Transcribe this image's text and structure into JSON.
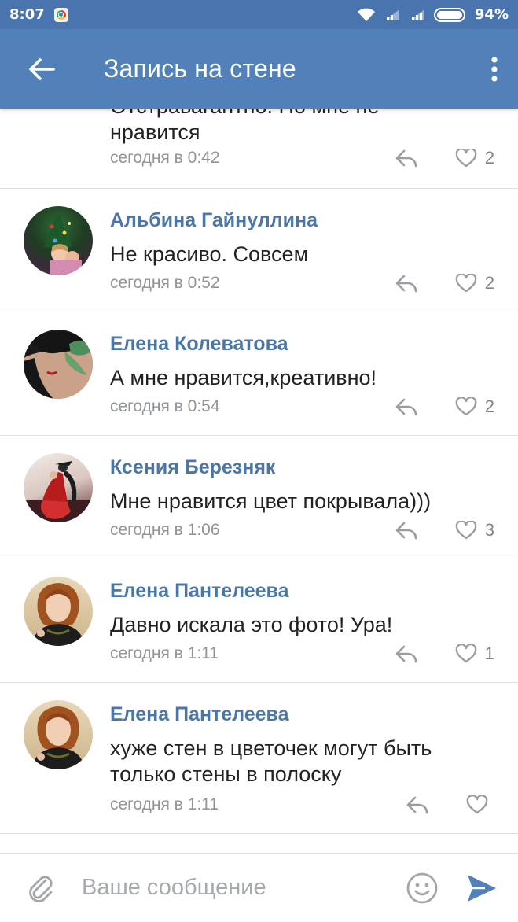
{
  "status_bar": {
    "time": "8:07",
    "battery": "94%"
  },
  "app_bar": {
    "title": "Запись на стене",
    "back_icon": "arrow-left-icon",
    "more_icon": "more-vertical-icon"
  },
  "comments": [
    {
      "author": "",
      "text_lines": [
        "Отстравагантно. Но мне не",
        "нравится"
      ],
      "time": "сегодня в 0:42",
      "likes": "2"
    },
    {
      "author": "Альбина Гайнуллина",
      "text_lines": [
        "Не красиво. Совсем"
      ],
      "time": "сегодня в 0:52",
      "likes": "2"
    },
    {
      "author": "Елена Колеватова",
      "text_lines": [
        "А мне нравится,креативно!"
      ],
      "time": "сегодня в 0:54",
      "likes": "2"
    },
    {
      "author": "Ксения Березняк",
      "text_lines": [
        "Мне нравится цвет покрывала)))"
      ],
      "time": "сегодня в 1:06",
      "likes": "3"
    },
    {
      "author": "Елена Пантелеева",
      "text_lines": [
        "Давно искала это фото! Ура!"
      ],
      "time": "сегодня в 1:11",
      "likes": "1"
    },
    {
      "author": "Елена Пантелеева",
      "text_lines": [
        "хуже стен в цветочек могут быть",
        "только стены в полоску"
      ],
      "time": "сегодня в 1:11",
      "likes": ""
    }
  ],
  "composer": {
    "placeholder": "Ваше сообщение",
    "value": ""
  },
  "colors": {
    "status_bar": "#4a74ad",
    "app_bar": "#5181b8",
    "author_link": "#4a76a8",
    "meta_text": "#909499",
    "icon_gray": "#9a9da1",
    "send_accent": "#5181b8"
  }
}
